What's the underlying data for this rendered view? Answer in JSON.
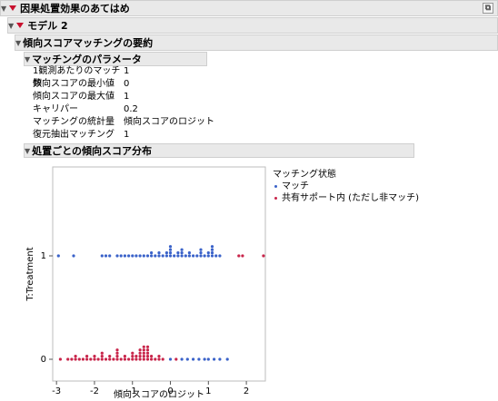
{
  "headers": {
    "root": "因果処置効果のあてはめ",
    "model": "モデル 2",
    "summary": "傾向スコアマッチングの要約",
    "params": "マッチングのパラメータ",
    "dist": "処置ごとの傾向スコア分布"
  },
  "params": [
    {
      "key": "1観測あたりのマッチ数",
      "value": "1"
    },
    {
      "key": "傾向スコアの最小値",
      "value": "0"
    },
    {
      "key": "傾向スコアの最大値",
      "value": "1"
    },
    {
      "key": "キャリパー",
      "value": "0.2"
    },
    {
      "key": "マッチングの統計量",
      "value": "傾向スコアのロジット"
    },
    {
      "key": "復元抽出マッチング",
      "value": "1"
    }
  ],
  "legend": {
    "title": "マッチング状態",
    "items": [
      {
        "label": "マッチ",
        "color": "#3a62c9"
      },
      {
        "label": "共有サポート内 (ただし非マッチ)",
        "color": "#c8254a"
      }
    ]
  },
  "chart_data": {
    "type": "scatter",
    "xlabel": "傾向スコアのロジット",
    "ylabel": "T:Treatment",
    "xlim": [
      -3.1,
      2.5
    ],
    "xticks": [
      "-3",
      "-2",
      "-1",
      "0",
      "1",
      "2"
    ],
    "yticks": [
      "0",
      "1"
    ],
    "series": [
      {
        "name": "マッチ",
        "color": "#3a62c9",
        "points": [
          {
            "x": -2.95,
            "y": 1
          },
          {
            "x": -2.55,
            "y": 1
          },
          {
            "x": -1.8,
            "y": 1
          },
          {
            "x": -1.7,
            "y": 1
          },
          {
            "x": -1.6,
            "y": 1
          },
          {
            "x": -1.4,
            "y": 1
          },
          {
            "x": -1.3,
            "y": 1
          },
          {
            "x": -1.2,
            "y": 1
          },
          {
            "x": -1.1,
            "y": 1
          },
          {
            "x": -1.0,
            "y": 1
          },
          {
            "x": -0.9,
            "y": 1
          },
          {
            "x": -0.8,
            "y": 1
          },
          {
            "x": -0.7,
            "y": 1
          },
          {
            "x": -0.6,
            "y": 1
          },
          {
            "x": -0.5,
            "y": 1
          },
          {
            "x": -0.4,
            "y": 1
          },
          {
            "x": -0.3,
            "y": 1
          },
          {
            "x": -0.2,
            "y": 1
          },
          {
            "x": -0.1,
            "y": 1
          },
          {
            "x": 0.0,
            "y": 1
          },
          {
            "x": 0.1,
            "y": 1
          },
          {
            "x": 0.2,
            "y": 1
          },
          {
            "x": 0.3,
            "y": 1
          },
          {
            "x": 0.4,
            "y": 1
          },
          {
            "x": 0.5,
            "y": 1
          },
          {
            "x": 0.6,
            "y": 1
          },
          {
            "x": 0.7,
            "y": 1
          },
          {
            "x": 0.8,
            "y": 1
          },
          {
            "x": 0.9,
            "y": 1
          },
          {
            "x": 1.0,
            "y": 1
          },
          {
            "x": 1.1,
            "y": 1
          },
          {
            "x": 1.2,
            "y": 1
          },
          {
            "x": 1.3,
            "y": 1
          },
          {
            "x": -0.5,
            "y": 1.03
          },
          {
            "x": -0.3,
            "y": 1.03
          },
          {
            "x": -0.1,
            "y": 1.03
          },
          {
            "x": 0.0,
            "y": 1.03
          },
          {
            "x": 0.2,
            "y": 1.03
          },
          {
            "x": 0.3,
            "y": 1.03
          },
          {
            "x": 0.5,
            "y": 1.03
          },
          {
            "x": 0.8,
            "y": 1.03
          },
          {
            "x": 1.0,
            "y": 1.03
          },
          {
            "x": 1.1,
            "y": 1.03
          },
          {
            "x": 0.0,
            "y": 1.06
          },
          {
            "x": 0.3,
            "y": 1.06
          },
          {
            "x": 0.8,
            "y": 1.06
          },
          {
            "x": 1.1,
            "y": 1.06
          },
          {
            "x": 0.0,
            "y": 1.09
          },
          {
            "x": 1.1,
            "y": 1.09
          },
          {
            "x": 0.0,
            "y": 0
          },
          {
            "x": 0.3,
            "y": 0
          },
          {
            "x": 0.45,
            "y": 0
          },
          {
            "x": 0.6,
            "y": 0
          },
          {
            "x": 0.75,
            "y": 0
          },
          {
            "x": 0.9,
            "y": 0
          },
          {
            "x": 1.0,
            "y": 0
          },
          {
            "x": 1.15,
            "y": 0
          },
          {
            "x": 1.3,
            "y": 0
          },
          {
            "x": 1.5,
            "y": 0
          }
        ]
      },
      {
        "name": "共有サポート内 (ただし非マッチ)",
        "color": "#c8254a",
        "points": [
          {
            "x": 1.8,
            "y": 1
          },
          {
            "x": 1.9,
            "y": 1
          },
          {
            "x": 2.45,
            "y": 1
          },
          {
            "x": -2.9,
            "y": 0
          },
          {
            "x": -2.7,
            "y": 0
          },
          {
            "x": -2.6,
            "y": 0
          },
          {
            "x": -2.5,
            "y": 0
          },
          {
            "x": -2.4,
            "y": 0
          },
          {
            "x": -2.3,
            "y": 0
          },
          {
            "x": -2.2,
            "y": 0
          },
          {
            "x": -2.1,
            "y": 0
          },
          {
            "x": -2.0,
            "y": 0
          },
          {
            "x": -1.9,
            "y": 0
          },
          {
            "x": -1.8,
            "y": 0
          },
          {
            "x": -1.7,
            "y": 0
          },
          {
            "x": -1.6,
            "y": 0
          },
          {
            "x": -1.5,
            "y": 0
          },
          {
            "x": -1.4,
            "y": 0
          },
          {
            "x": -1.3,
            "y": 0
          },
          {
            "x": -1.2,
            "y": 0
          },
          {
            "x": -1.1,
            "y": 0
          },
          {
            "x": -1.0,
            "y": 0
          },
          {
            "x": -0.9,
            "y": 0
          },
          {
            "x": -0.8,
            "y": 0
          },
          {
            "x": -0.7,
            "y": 0
          },
          {
            "x": -0.6,
            "y": 0
          },
          {
            "x": -0.5,
            "y": 0
          },
          {
            "x": -0.4,
            "y": 0
          },
          {
            "x": -0.3,
            "y": 0
          },
          {
            "x": -0.2,
            "y": 0
          },
          {
            "x": 0.15,
            "y": 0
          },
          {
            "x": -2.5,
            "y": 0.03
          },
          {
            "x": -2.2,
            "y": 0.03
          },
          {
            "x": -2.0,
            "y": 0.03
          },
          {
            "x": -1.8,
            "y": 0.03
          },
          {
            "x": -1.6,
            "y": 0.03
          },
          {
            "x": -1.4,
            "y": 0.03
          },
          {
            "x": -1.2,
            "y": 0.03
          },
          {
            "x": -1.0,
            "y": 0.03
          },
          {
            "x": -0.9,
            "y": 0.03
          },
          {
            "x": -0.8,
            "y": 0.03
          },
          {
            "x": -0.7,
            "y": 0.03
          },
          {
            "x": -0.6,
            "y": 0.03
          },
          {
            "x": -0.5,
            "y": 0.03
          },
          {
            "x": -0.3,
            "y": 0.03
          },
          {
            "x": -1.8,
            "y": 0.06
          },
          {
            "x": -1.4,
            "y": 0.06
          },
          {
            "x": -1.0,
            "y": 0.06
          },
          {
            "x": -0.8,
            "y": 0.06
          },
          {
            "x": -0.7,
            "y": 0.06
          },
          {
            "x": -0.6,
            "y": 0.06
          },
          {
            "x": -1.4,
            "y": 0.09
          },
          {
            "x": -0.8,
            "y": 0.09
          },
          {
            "x": -0.7,
            "y": 0.09
          },
          {
            "x": -0.6,
            "y": 0.09
          },
          {
            "x": -0.7,
            "y": 0.12
          },
          {
            "x": -0.6,
            "y": 0.12
          }
        ]
      }
    ]
  }
}
